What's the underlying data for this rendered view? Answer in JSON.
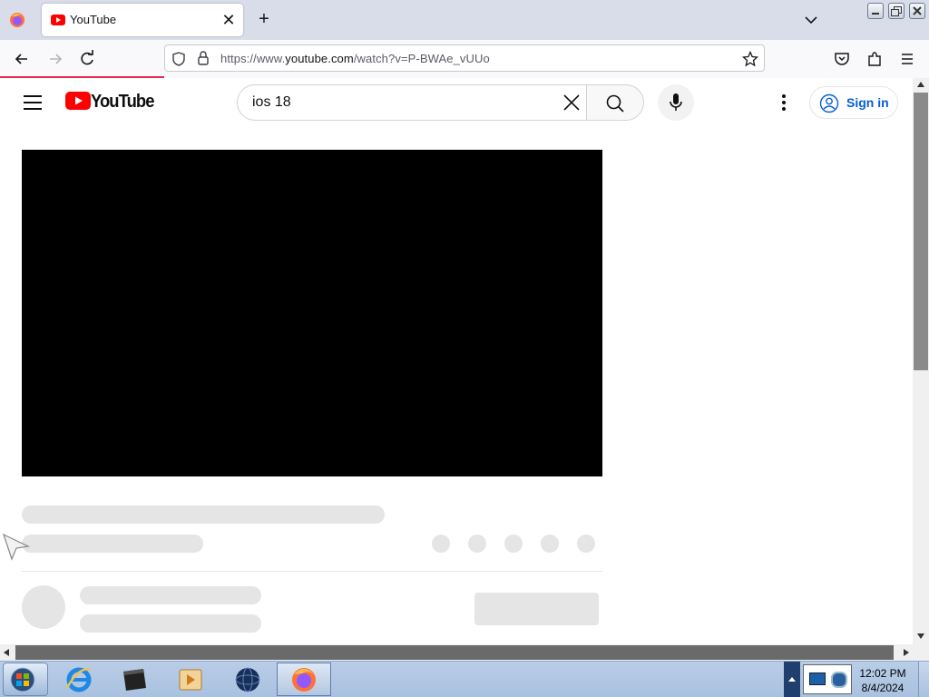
{
  "browser": {
    "tab_title": "YouTube",
    "url_prefix": "https://www.",
    "url_domain": "youtube.com",
    "url_path": "/watch?v=P-BWAe_vUUo"
  },
  "youtube": {
    "logo_text": "YouTube",
    "search_value": "ios 18",
    "signin_label": "Sign in"
  },
  "taskbar": {
    "time": "12:02 PM",
    "date": "8/4/2024"
  },
  "colors": {
    "youtube_red": "#ff0000",
    "link_blue": "#065fd4",
    "load_bar": "#e22850"
  }
}
